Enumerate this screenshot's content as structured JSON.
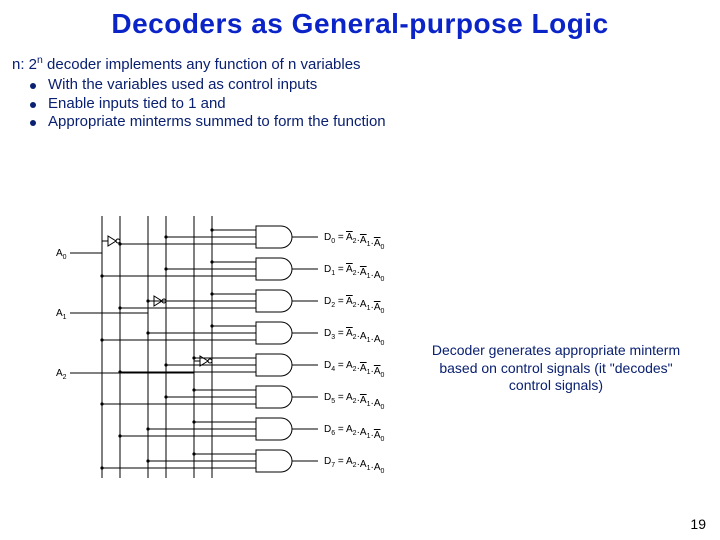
{
  "title": "Decoders as General-purpose Logic",
  "lead_prefix": "n: 2",
  "lead_sup": "n",
  "lead_suffix": " decoder implements any function of n variables",
  "bullets": [
    "With the variables used as control inputs",
    "Enable inputs tied to 1 and",
    "Appropriate minterms summed to form the function"
  ],
  "note": "Decoder generates appropriate minterm based on control signals (it \"decodes\" control signals)",
  "page_number": "19",
  "inputs": [
    "A",
    "A",
    "A"
  ],
  "input_subs": [
    "0",
    "1",
    "2"
  ],
  "outputs": [
    {
      "name": "D",
      "sub": "0",
      "terms": [
        "A2b",
        "A1b",
        "A0b"
      ]
    },
    {
      "name": "D",
      "sub": "1",
      "terms": [
        "A2b",
        "A1b",
        "A0"
      ]
    },
    {
      "name": "D",
      "sub": "2",
      "terms": [
        "A2b",
        "A1",
        "A0b"
      ]
    },
    {
      "name": "D",
      "sub": "3",
      "terms": [
        "A2b",
        "A1",
        "A0"
      ]
    },
    {
      "name": "D",
      "sub": "4",
      "terms": [
        "A2",
        "A1b",
        "A0b"
      ]
    },
    {
      "name": "D",
      "sub": "5",
      "terms": [
        "A2",
        "A1b",
        "A0"
      ]
    },
    {
      "name": "D",
      "sub": "6",
      "terms": [
        "A2",
        "A1",
        "A0b"
      ]
    },
    {
      "name": "D",
      "sub": "7",
      "terms": [
        "A2",
        "A1",
        "A0"
      ]
    }
  ]
}
